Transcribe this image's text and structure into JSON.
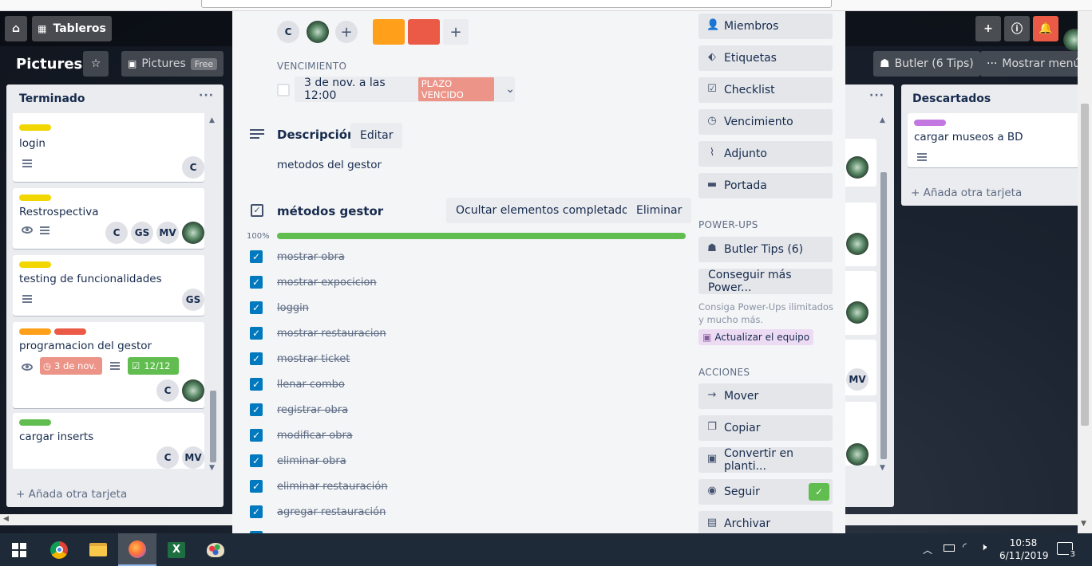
{
  "header": {
    "boards_label": "Tableros"
  },
  "board": {
    "title": "Pictures",
    "team_name": "Pictures",
    "team_plan": "Free",
    "butler_label": "Butler (6 Tips)",
    "menu_label": "Mostrar menú"
  },
  "lists": [
    {
      "title": "Terminado",
      "add_label": "Añada otra tarjeta",
      "cards": [
        {
          "title": "login",
          "labels": [
            "#f2d600"
          ],
          "avatars": [
            "C"
          ]
        },
        {
          "title": "Restrospectiva",
          "labels": [
            "#f2d600"
          ],
          "avatars": [
            "C",
            "GS",
            "MV"
          ]
        },
        {
          "title": "testing de funcionalidades",
          "labels": [
            "#f2d600"
          ],
          "avatars": [
            "GS"
          ]
        },
        {
          "title": "programacion del gestor",
          "labels": [
            "#ff9f1a",
            "#eb5a46"
          ],
          "due": "3 de nov.",
          "checklist": "12/12",
          "avatars": [
            "C"
          ]
        },
        {
          "title": "cargar inserts",
          "labels": [
            "#61bd4f"
          ],
          "avatars": [
            "C",
            "MV"
          ]
        }
      ]
    },
    {
      "title": "Descartados",
      "add_label": "Añada otra tarjeta",
      "cards": [
        {
          "title": "cargar museos a BD",
          "labels": [
            "#c377e0"
          ]
        }
      ]
    }
  ],
  "hidden_list_avatar": "MV",
  "card_detail": {
    "member_initial": "C",
    "label_colors": [
      "#ff9f1a",
      "#eb5a46"
    ],
    "due_section": "VENCIMIENTO",
    "due_text": "3 de nov. a las 12:00",
    "due_badge": "PLAZO VENCIDO",
    "description_title": "Descripción",
    "edit_label": "Editar",
    "description_text": "metodos del gestor",
    "checklist": {
      "title": "métodos gestor",
      "hide_label": "Ocultar elementos completados",
      "delete_label": "Eliminar",
      "progress_label": "100%",
      "progress": 1.0,
      "items": [
        "mostrar obra",
        "mostrar expocicion",
        "loggin",
        "mostrar restauracion",
        "mostrar ticket",
        "llenar combo",
        "registrar obra",
        "modificar obra",
        "eliminar obra",
        "eliminar restauración",
        "agregar restauración"
      ]
    }
  },
  "sidebar": {
    "add_items": [
      "Miembros",
      "Etiquetas",
      "Checklist",
      "Vencimiento",
      "Adjunto",
      "Portada"
    ],
    "powerups_title": "POWER-UPS",
    "butler_tips": "Butler Tips (6)",
    "more_powerups": "Conseguir más Power...",
    "powerups_hint": "Consiga Power-Ups ilimitados y mucho más.",
    "upgrade_label": "Actualizar el equipo",
    "actions_title": "ACCIONES",
    "actions": [
      "Mover",
      "Copiar",
      "Convertir en planti...",
      "Seguir",
      "Archivar"
    ]
  },
  "taskbar": {
    "time": "10:58",
    "date": "6/11/2019",
    "notifications": "3"
  },
  "colors": {
    "accent": "#0079bf",
    "green": "#61bd4f",
    "overdue": "#ec9488"
  }
}
